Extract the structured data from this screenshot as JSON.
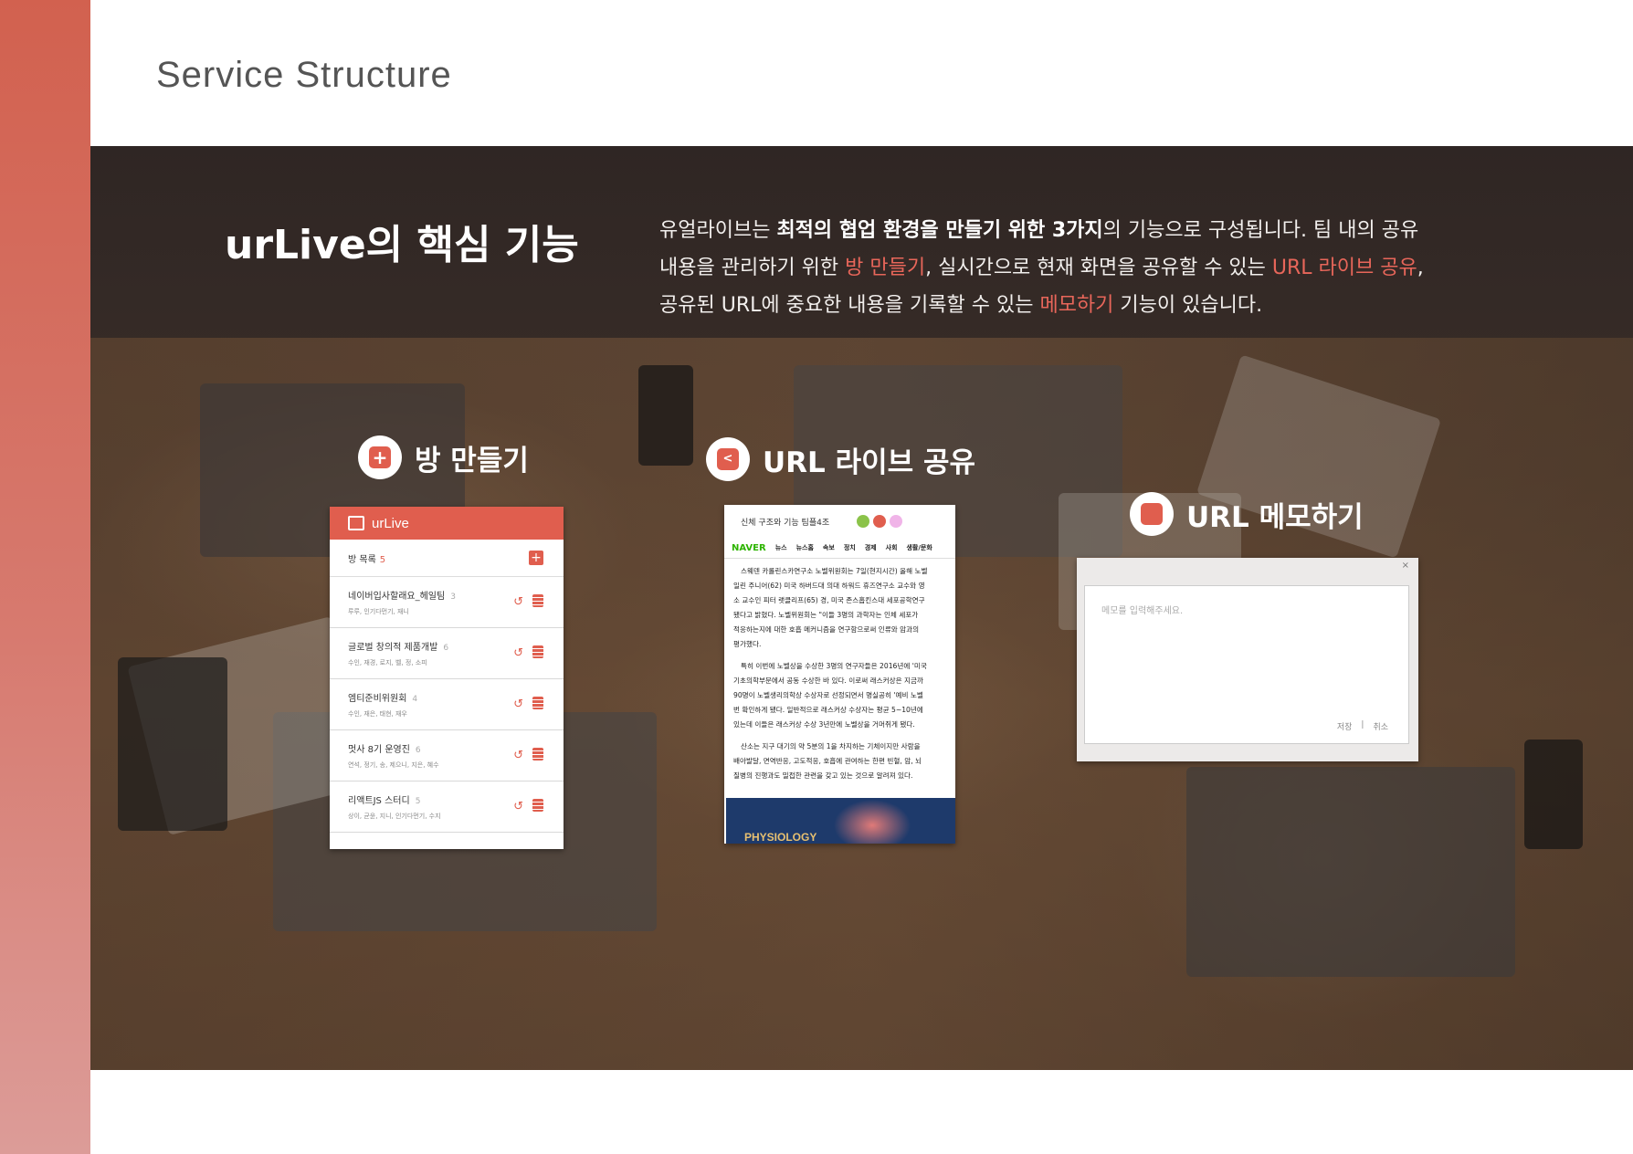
{
  "page": {
    "title": "Service Structure"
  },
  "intro": {
    "heading": "urLive의 핵심 기능",
    "line1_a": "유얼라이브는 ",
    "line1_b": "최적의 협업 환경을 만들기 위한 3가지",
    "line1_c": "의 기능으로 구성됩니다. 팀 내의 공유",
    "line2_a": "내용을 관리하기 위한 ",
    "line2_hl1": "방 만들기",
    "line2_b": ", 실시간으로 현재 화면을 공유할 수 있는 ",
    "line2_hl2": "URL 라이브 공유",
    "line2_c": ",",
    "line3_a": "공유된 URL에 중요한 내용을 기록할 수 있는 ",
    "line3_hl": "메모하기",
    "line3_b": " 기능이 있습니다."
  },
  "features": {
    "room": {
      "label": "방 만들기",
      "icon": "plus-icon"
    },
    "share": {
      "label": "URL 라이브 공유",
      "icon": "share-icon"
    },
    "memo": {
      "label": "URL 메모하기",
      "icon": "memo-icon"
    }
  },
  "room_card": {
    "logo": "urLive",
    "list_title": "방 목록",
    "list_count": "5",
    "add_label": "+",
    "rooms": [
      {
        "name": "네이버입사할래요_헤일팀",
        "count": "3",
        "members": "루루, 인기다먼기, 재니"
      },
      {
        "name": "글로벌 창의적 제품개발",
        "count": "6",
        "members": "수인, 재경, 로지, 벨, 정, 소피"
      },
      {
        "name": "엠티준비위원회",
        "count": "4",
        "members": "수인, 재은, 태현, 재우"
      },
      {
        "name": "멋사 8기 운영진",
        "count": "6",
        "members": "연석, 정기, 송, 제으니, 지은, 혜수"
      },
      {
        "name": "리액트JS 스터디",
        "count": "5",
        "members": "상이, 균윤, 지니, 인기다먼기, 수지"
      }
    ]
  },
  "share_card": {
    "tab_title": "신체 구조와 기능 팀플4조",
    "participant_colors": [
      "#8bc34a",
      "#e05e4e",
      "#f0b4e8"
    ],
    "nav": [
      "NAVER",
      "뉴스",
      "뉴스홈",
      "속보",
      "정치",
      "경제",
      "사회",
      "생활/문화"
    ],
    "paragraphs": [
      [
        "스웨덴 카롤린스카연구소 노벨위원회는 7일(현지시간) 올해 노벨",
        "일린 주니어(62) 미국 하버드대 의대 하워드 휴즈연구소 교수와 영",
        "소 교수인 피터 랫클리프(65) 경, 미국 존스홉킨스대 세포공학연구",
        "됐다고 밝혔다. 노벨위원회는 \"이들 3명의 과학자는 인체 세포가 ",
        "적응하는지에 대한 호흡 메커니즘을 연구함으로써 인류와 암과의 ",
        "평가했다."
      ],
      [
        "특히 이번에 노벨상을 수상한 3명의 연구자들은 2016년에 '미국",
        "기초의학부문에서 공동 수상한 바 있다. 이로써 래스커상은 지금까",
        "90명이 노벨생리의학상 수상자로 선정되면서 명실공히 '예비 노벨",
        "번 확인하게 됐다. 일반적으로 래스커상 수상자는 평균 5~10년에",
        "있는데 이들은 래스커상 수상 3년만에 노벨상을 거머쥐게 됐다."
      ],
      [
        "산소는 지구 대기의 약 5분의 1을 차지하는 기체이지만 사람을 ",
        "배아발달, 면역반응, 고도적응, 호흡에 관여하는 한편 빈혈, 암, 뇌",
        "질병의 진행과도 밀접한 관련을 갖고 있는 것으로 알려져 있다."
      ]
    ],
    "image_caption": "PHYSIOLOGY"
  },
  "memo_card": {
    "close_label": "×",
    "placeholder": "메모를 입력해주세요.",
    "save_label": "저장",
    "separator": "|",
    "cancel_label": "취소"
  },
  "colors": {
    "accent": "#e05e4e",
    "sidebar": "#d2614f"
  }
}
